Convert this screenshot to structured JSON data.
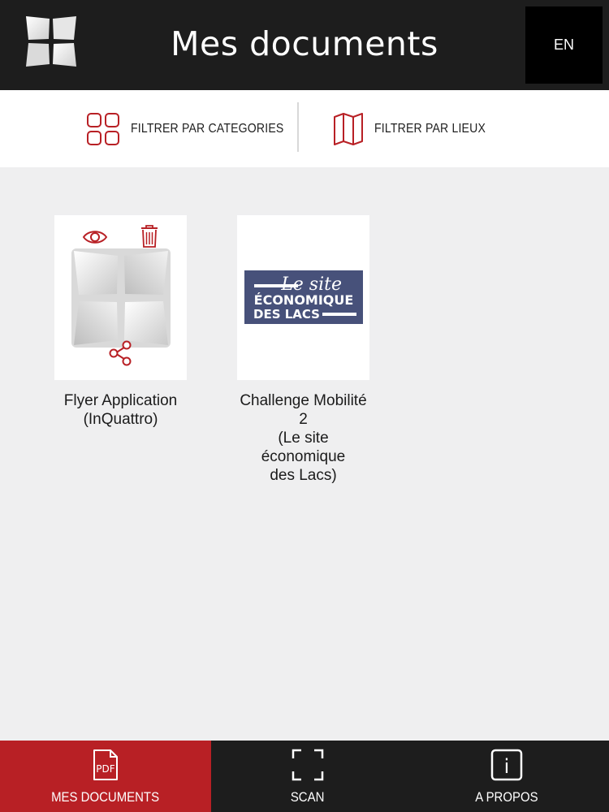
{
  "header": {
    "title": "Mes documents",
    "lang_label": "EN",
    "logo_icon": "four-squares-logo-icon"
  },
  "filters": {
    "categories_label": "FILTRER PAR CATEGORIES",
    "categories_icon": "grid-icon",
    "places_label": "FILTRER PAR LIEUX",
    "places_icon": "map-icon",
    "accent": "#b82025"
  },
  "documents": [
    {
      "title_lines": [
        "Flyer Application",
        "(InQuattro)"
      ],
      "actions": [
        "eye-icon",
        "trash-icon",
        "share-icon"
      ]
    },
    {
      "title_lines": [
        "Challenge Mobilité 2",
        "(Le site économique",
        "des Lacs)"
      ],
      "logo": {
        "line1": "Le site",
        "line2": "ÉCONOMIQUE",
        "line3": "DES LACS",
        "color": "#47517a"
      }
    }
  ],
  "tabbar": {
    "tabs": [
      {
        "label": "MES DOCUMENTS",
        "icon": "pdf-icon",
        "icon_text": "PDF",
        "active": true
      },
      {
        "label": "SCAN",
        "icon": "scan-icon",
        "active": false
      },
      {
        "label": "A PROPOS",
        "icon": "info-icon",
        "icon_text": "i",
        "active": false
      }
    ],
    "active_color": "#b82025"
  }
}
